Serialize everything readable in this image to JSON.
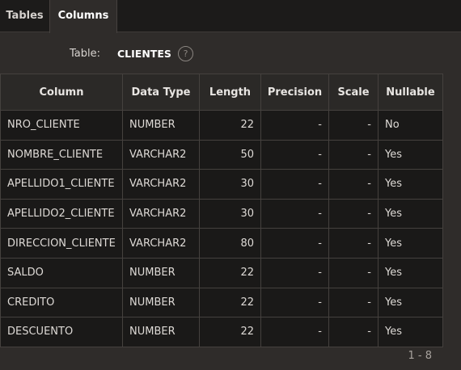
{
  "tabs": [
    {
      "label": "Tables",
      "active": false
    },
    {
      "label": "Columns",
      "active": true
    }
  ],
  "table_info": {
    "label": "Table:",
    "value": "CLIENTES",
    "help_icon": "?"
  },
  "grid": {
    "headers": [
      "Column",
      "Data Type",
      "Length",
      "Precision",
      "Scale",
      "Nullable"
    ],
    "rows": [
      [
        "NRO_CLIENTE",
        "NUMBER",
        "22",
        "-",
        "-",
        "No"
      ],
      [
        "NOMBRE_CLIENTE",
        "VARCHAR2",
        "50",
        "-",
        "-",
        "Yes"
      ],
      [
        "APELLIDO1_CLIENTE",
        "VARCHAR2",
        "30",
        "-",
        "-",
        "Yes"
      ],
      [
        "APELLIDO2_CLIENTE",
        "VARCHAR2",
        "30",
        "-",
        "-",
        "Yes"
      ],
      [
        "DIRECCION_CLIENTE",
        "VARCHAR2",
        "80",
        "-",
        "-",
        "Yes"
      ],
      [
        "SALDO",
        "NUMBER",
        "22",
        "-",
        "-",
        "Yes"
      ],
      [
        "CREDITO",
        "NUMBER",
        "22",
        "-",
        "-",
        "Yes"
      ],
      [
        "DESCUENTO",
        "NUMBER",
        "22",
        "-",
        "-",
        "Yes"
      ]
    ]
  },
  "pagination": "1 - 8",
  "colors": {
    "background": "#2f2c2a",
    "tabbar": "#1c1b1a",
    "cell_bg": "#1a1918",
    "border": "#45413e"
  }
}
